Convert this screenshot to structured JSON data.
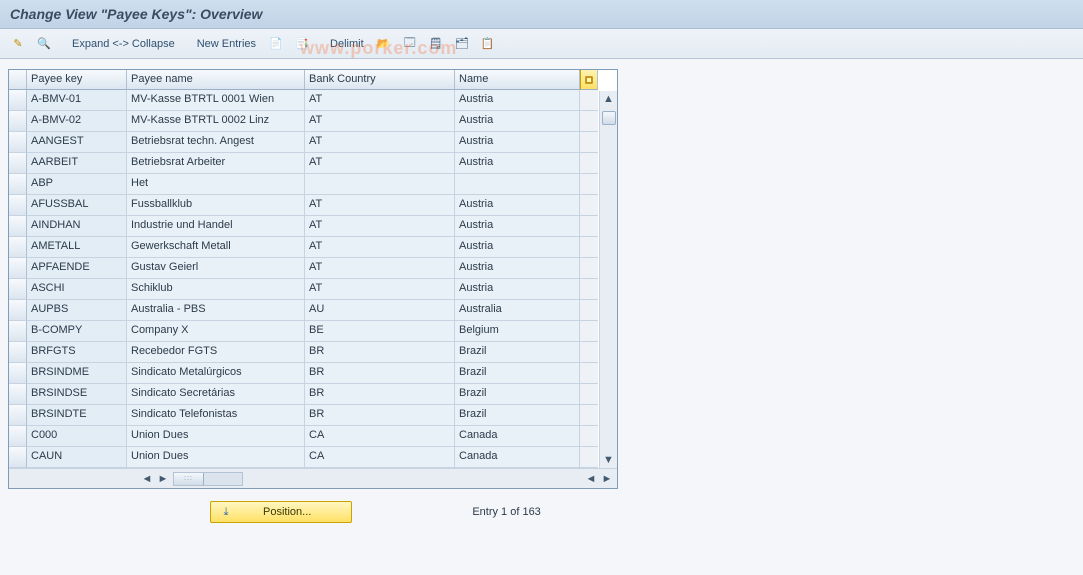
{
  "title": "Change View \"Payee Keys\": Overview",
  "toolbar": {
    "expand": "Expand <-> Collapse",
    "new_entries": "New Entries",
    "delimit": "Delimit"
  },
  "watermark": "www.porker.com",
  "columns": {
    "payee_key": "Payee key",
    "payee_name": "Payee name",
    "bank_country": "Bank Country",
    "name": "Name"
  },
  "rows": [
    {
      "key": "A-BMV-01",
      "name": "MV-Kasse  BTRTL 0001 Wien",
      "bc": "AT",
      "country": "Austria"
    },
    {
      "key": "A-BMV-02",
      "name": "MV-Kasse  BTRTL 0002 Linz",
      "bc": "AT",
      "country": "Austria"
    },
    {
      "key": "AANGEST",
      "name": "Betriebsrat techn. Angest",
      "bc": "AT",
      "country": "Austria"
    },
    {
      "key": "AARBEIT",
      "name": "Betriebsrat Arbeiter",
      "bc": "AT",
      "country": "Austria"
    },
    {
      "key": "ABP",
      "name": "Het",
      "bc": "",
      "country": ""
    },
    {
      "key": "AFUSSBAL",
      "name": "Fussballklub",
      "bc": "AT",
      "country": "Austria"
    },
    {
      "key": "AINDHAN",
      "name": "Industrie und Handel",
      "bc": "AT",
      "country": "Austria"
    },
    {
      "key": "AMETALL",
      "name": "Gewerkschaft Metall",
      "bc": "AT",
      "country": "Austria"
    },
    {
      "key": "APFAENDE",
      "name": "Gustav Geierl",
      "bc": "AT",
      "country": "Austria"
    },
    {
      "key": "ASCHI",
      "name": "Schiklub",
      "bc": "AT",
      "country": "Austria"
    },
    {
      "key": "AUPBS",
      "name": "Australia - PBS",
      "bc": "AU",
      "country": "Australia"
    },
    {
      "key": "B-COMPY",
      "name": "Company X",
      "bc": "BE",
      "country": "Belgium"
    },
    {
      "key": "BRFGTS",
      "name": "Recebedor FGTS",
      "bc": "BR",
      "country": "Brazil"
    },
    {
      "key": "BRSINDME",
      "name": "Sindicato Metalúrgicos",
      "bc": "BR",
      "country": "Brazil"
    },
    {
      "key": "BRSINDSE",
      "name": "Sindicato Secretárias",
      "bc": "BR",
      "country": "Brazil"
    },
    {
      "key": "BRSINDTE",
      "name": "Sindicato Telefonistas",
      "bc": "BR",
      "country": "Brazil"
    },
    {
      "key": "C000",
      "name": "Union Dues",
      "bc": "CA",
      "country": "Canada"
    },
    {
      "key": "CAUN",
      "name": "Union Dues",
      "bc": "CA",
      "country": "Canada"
    }
  ],
  "footer": {
    "position_label": "Position...",
    "entry_label": "Entry 1 of 163"
  }
}
